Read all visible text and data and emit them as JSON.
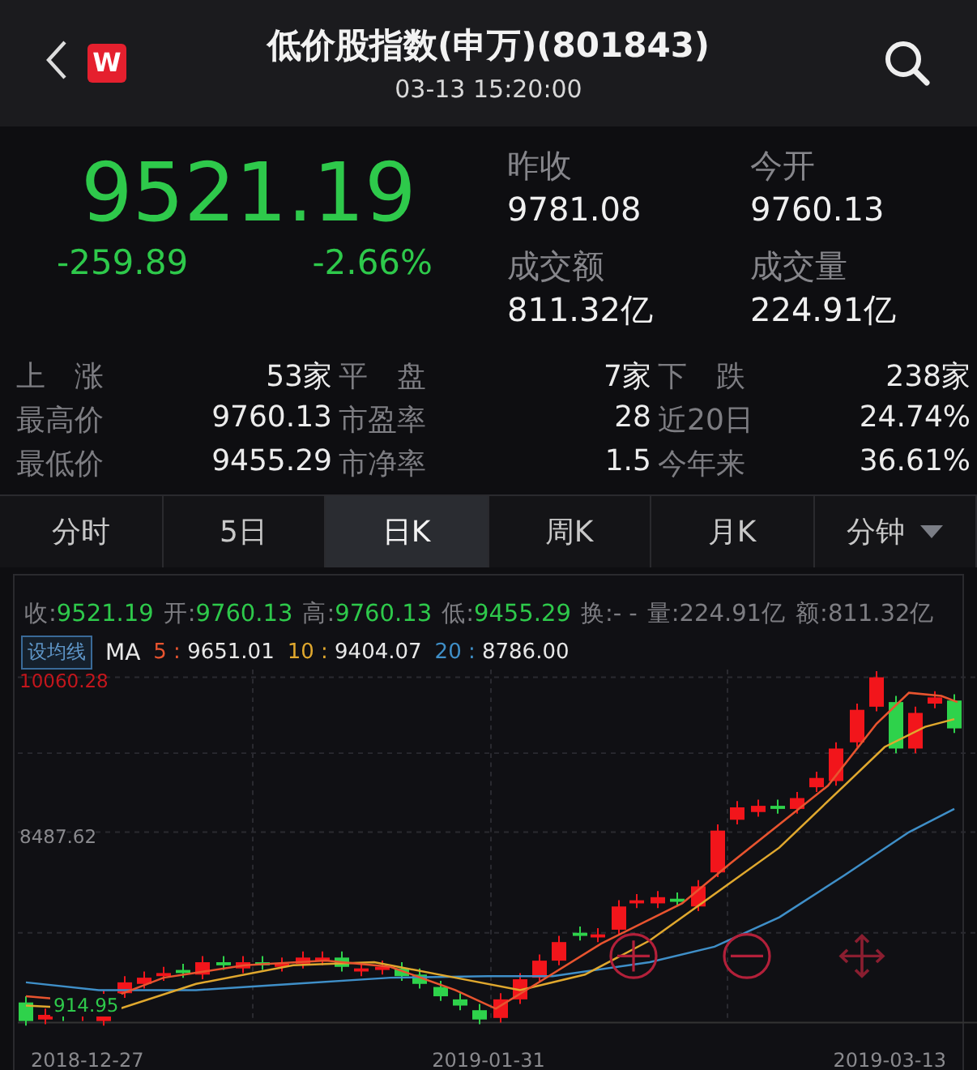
{
  "header": {
    "logo": "W",
    "title": "低价股指数(申万)(801843)",
    "time": "03-13 15:20:00"
  },
  "quote": {
    "price": "9521.19",
    "change": "-259.89",
    "change_pct": "-2.66%",
    "fields": [
      {
        "label": "昨收",
        "value": "9781.08"
      },
      {
        "label": "今开",
        "value": "9760.13"
      },
      {
        "label": "成交额",
        "value": "811.32亿"
      },
      {
        "label": "成交量",
        "value": "224.91亿"
      }
    ]
  },
  "stats": [
    [
      {
        "label": "上　涨",
        "value": "53家"
      },
      {
        "label": "平　盘",
        "value": "7家"
      },
      {
        "label": "下　跌",
        "value": "238家"
      }
    ],
    [
      {
        "label": "最高价",
        "value": "9760.13"
      },
      {
        "label": "市盈率",
        "value": "28"
      },
      {
        "label": "近20日",
        "value": "24.74%"
      }
    ],
    [
      {
        "label": "最低价",
        "value": "9455.29"
      },
      {
        "label": "市净率",
        "value": "1.5"
      },
      {
        "label": "今年来",
        "value": "36.61%"
      }
    ]
  ],
  "tabs": [
    {
      "label": "分时",
      "selected": false,
      "kind": "period"
    },
    {
      "label": "5日",
      "selected": false,
      "kind": "period"
    },
    {
      "label": "日K",
      "selected": true,
      "kind": "period"
    },
    {
      "label": "周K",
      "selected": false,
      "kind": "period"
    },
    {
      "label": "月K",
      "selected": false,
      "kind": "period"
    },
    {
      "label": "分钟",
      "selected": false,
      "kind": "menu"
    }
  ],
  "chart": {
    "info": [
      {
        "label": "收:",
        "value": "9521.19",
        "color": "#2ec94b"
      },
      {
        "label": "开:",
        "value": "9760.13",
        "color": "#2ec94b"
      },
      {
        "label": "高:",
        "value": "9760.13",
        "color": "#2ec94b"
      },
      {
        "label": "低:",
        "value": "9455.29",
        "color": "#2ec94b"
      },
      {
        "label": "换:",
        "value": "- -",
        "color": "#7d7d82"
      },
      {
        "label": "量:",
        "value": "224.91亿",
        "color": "#7d7d82"
      },
      {
        "label": "额:",
        "value": "811.32亿",
        "color": "#7d7d82"
      }
    ],
    "ma_button": "设均线",
    "ma_label": "MA",
    "ma_lines": [
      {
        "label": "5 :",
        "value": "9651.01",
        "color": "#e8542f"
      },
      {
        "label": "10 :",
        "value": "9404.07",
        "color": "#e0a82e"
      },
      {
        "label": "20 :",
        "value": "8786.00",
        "color": "#3f8fc8"
      }
    ],
    "y_labels": [
      {
        "text": "10060.28",
        "color": "#c4161c"
      },
      {
        "text": "8487.62",
        "color": "#8a8a8e"
      },
      {
        "text": "914.95",
        "color": "#2ec94b"
      }
    ],
    "x_labels": [
      "2018-12-27",
      "2019-01-31",
      "2019-03-13"
    ]
  }
}
